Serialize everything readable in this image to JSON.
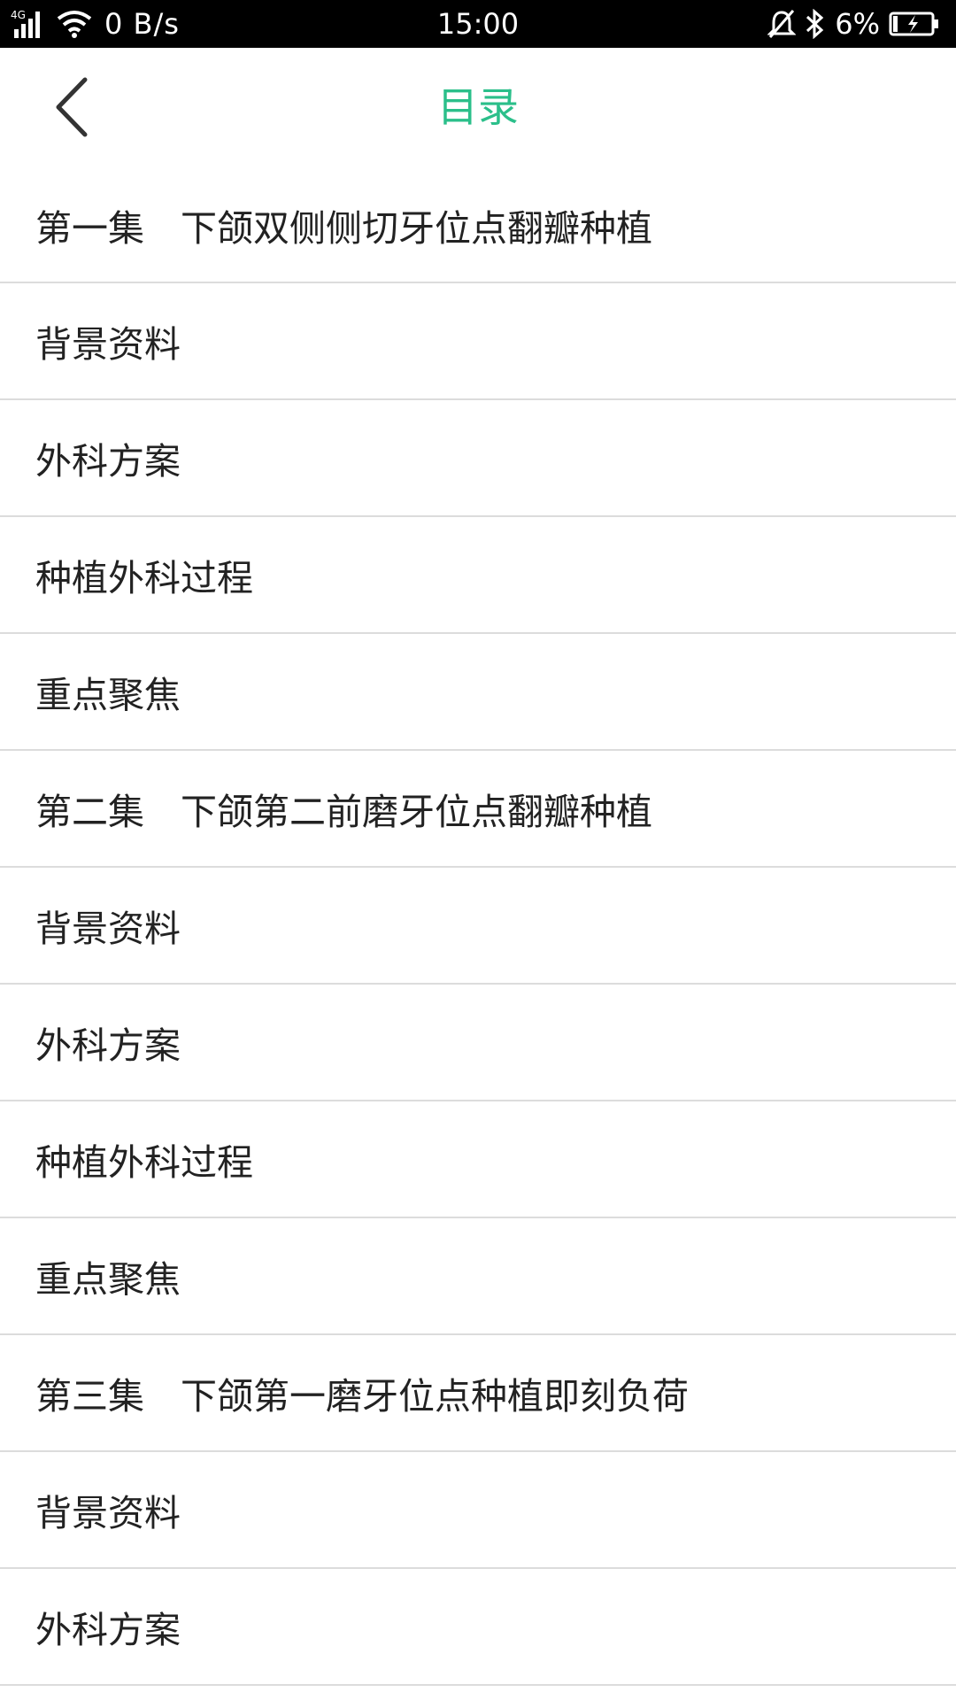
{
  "status_bar": {
    "network_type": "4G",
    "net_speed": "0 B/s",
    "time": "15:00",
    "battery": "6%",
    "icons": [
      "signal-icon",
      "wifi-icon",
      "mute-bell-icon",
      "bluetooth-icon",
      "battery-charging-icon"
    ]
  },
  "header": {
    "title": "目录",
    "back_icon": "chevron-left-icon",
    "title_color": "#2bbf8a"
  },
  "toc": {
    "items": [
      {
        "label": "第一集　下颌双侧侧切牙位点翻瓣种植"
      },
      {
        "label": "背景资料"
      },
      {
        "label": "外科方案"
      },
      {
        "label": "种植外科过程"
      },
      {
        "label": "重点聚焦"
      },
      {
        "label": "第二集　下颌第二前磨牙位点翻瓣种植"
      },
      {
        "label": "背景资料"
      },
      {
        "label": "外科方案"
      },
      {
        "label": "种植外科过程"
      },
      {
        "label": "重点聚焦"
      },
      {
        "label": "第三集　下颌第一磨牙位点种植即刻负荷"
      },
      {
        "label": "背景资料"
      },
      {
        "label": "外科方案"
      }
    ]
  }
}
